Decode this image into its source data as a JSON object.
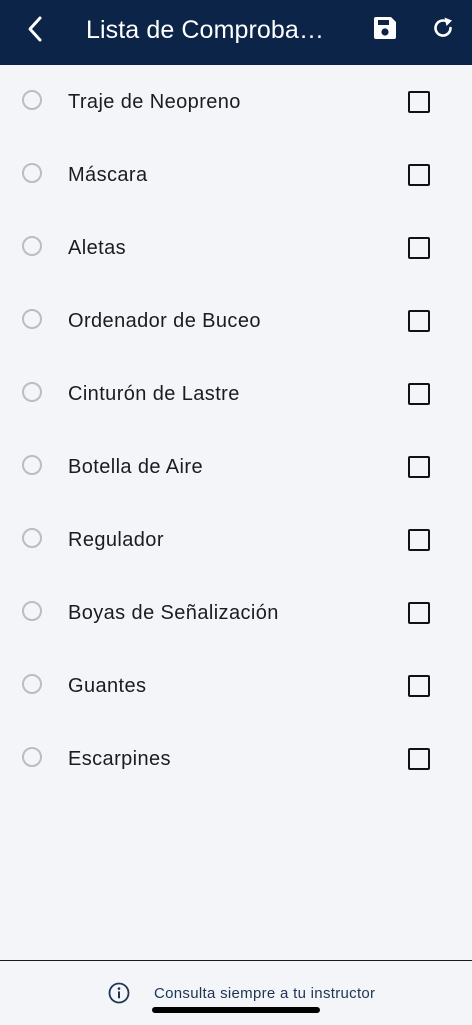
{
  "header": {
    "title": "Lista de Comprobaci...",
    "back_icon": "chevron-left-icon",
    "save_icon": "floppy-disk-icon",
    "refresh_icon": "refresh-icon"
  },
  "items": [
    {
      "label": "Traje de Neopreno"
    },
    {
      "label": "Máscara"
    },
    {
      "label": "Aletas"
    },
    {
      "label": "Ordenador de Buceo"
    },
    {
      "label": "Cinturón de Lastre"
    },
    {
      "label": "Botella de Aire"
    },
    {
      "label": "Regulador"
    },
    {
      "label": "Boyas de Señalización"
    },
    {
      "label": "Guantes"
    },
    {
      "label": "Escarpines"
    }
  ],
  "footer": {
    "text": "Consulta siempre a tu instructor",
    "icon": "info-icon"
  },
  "colors": {
    "header_bg": "#0b2447",
    "page_bg": "#f4f5f9",
    "footer_text": "#1d3553"
  }
}
